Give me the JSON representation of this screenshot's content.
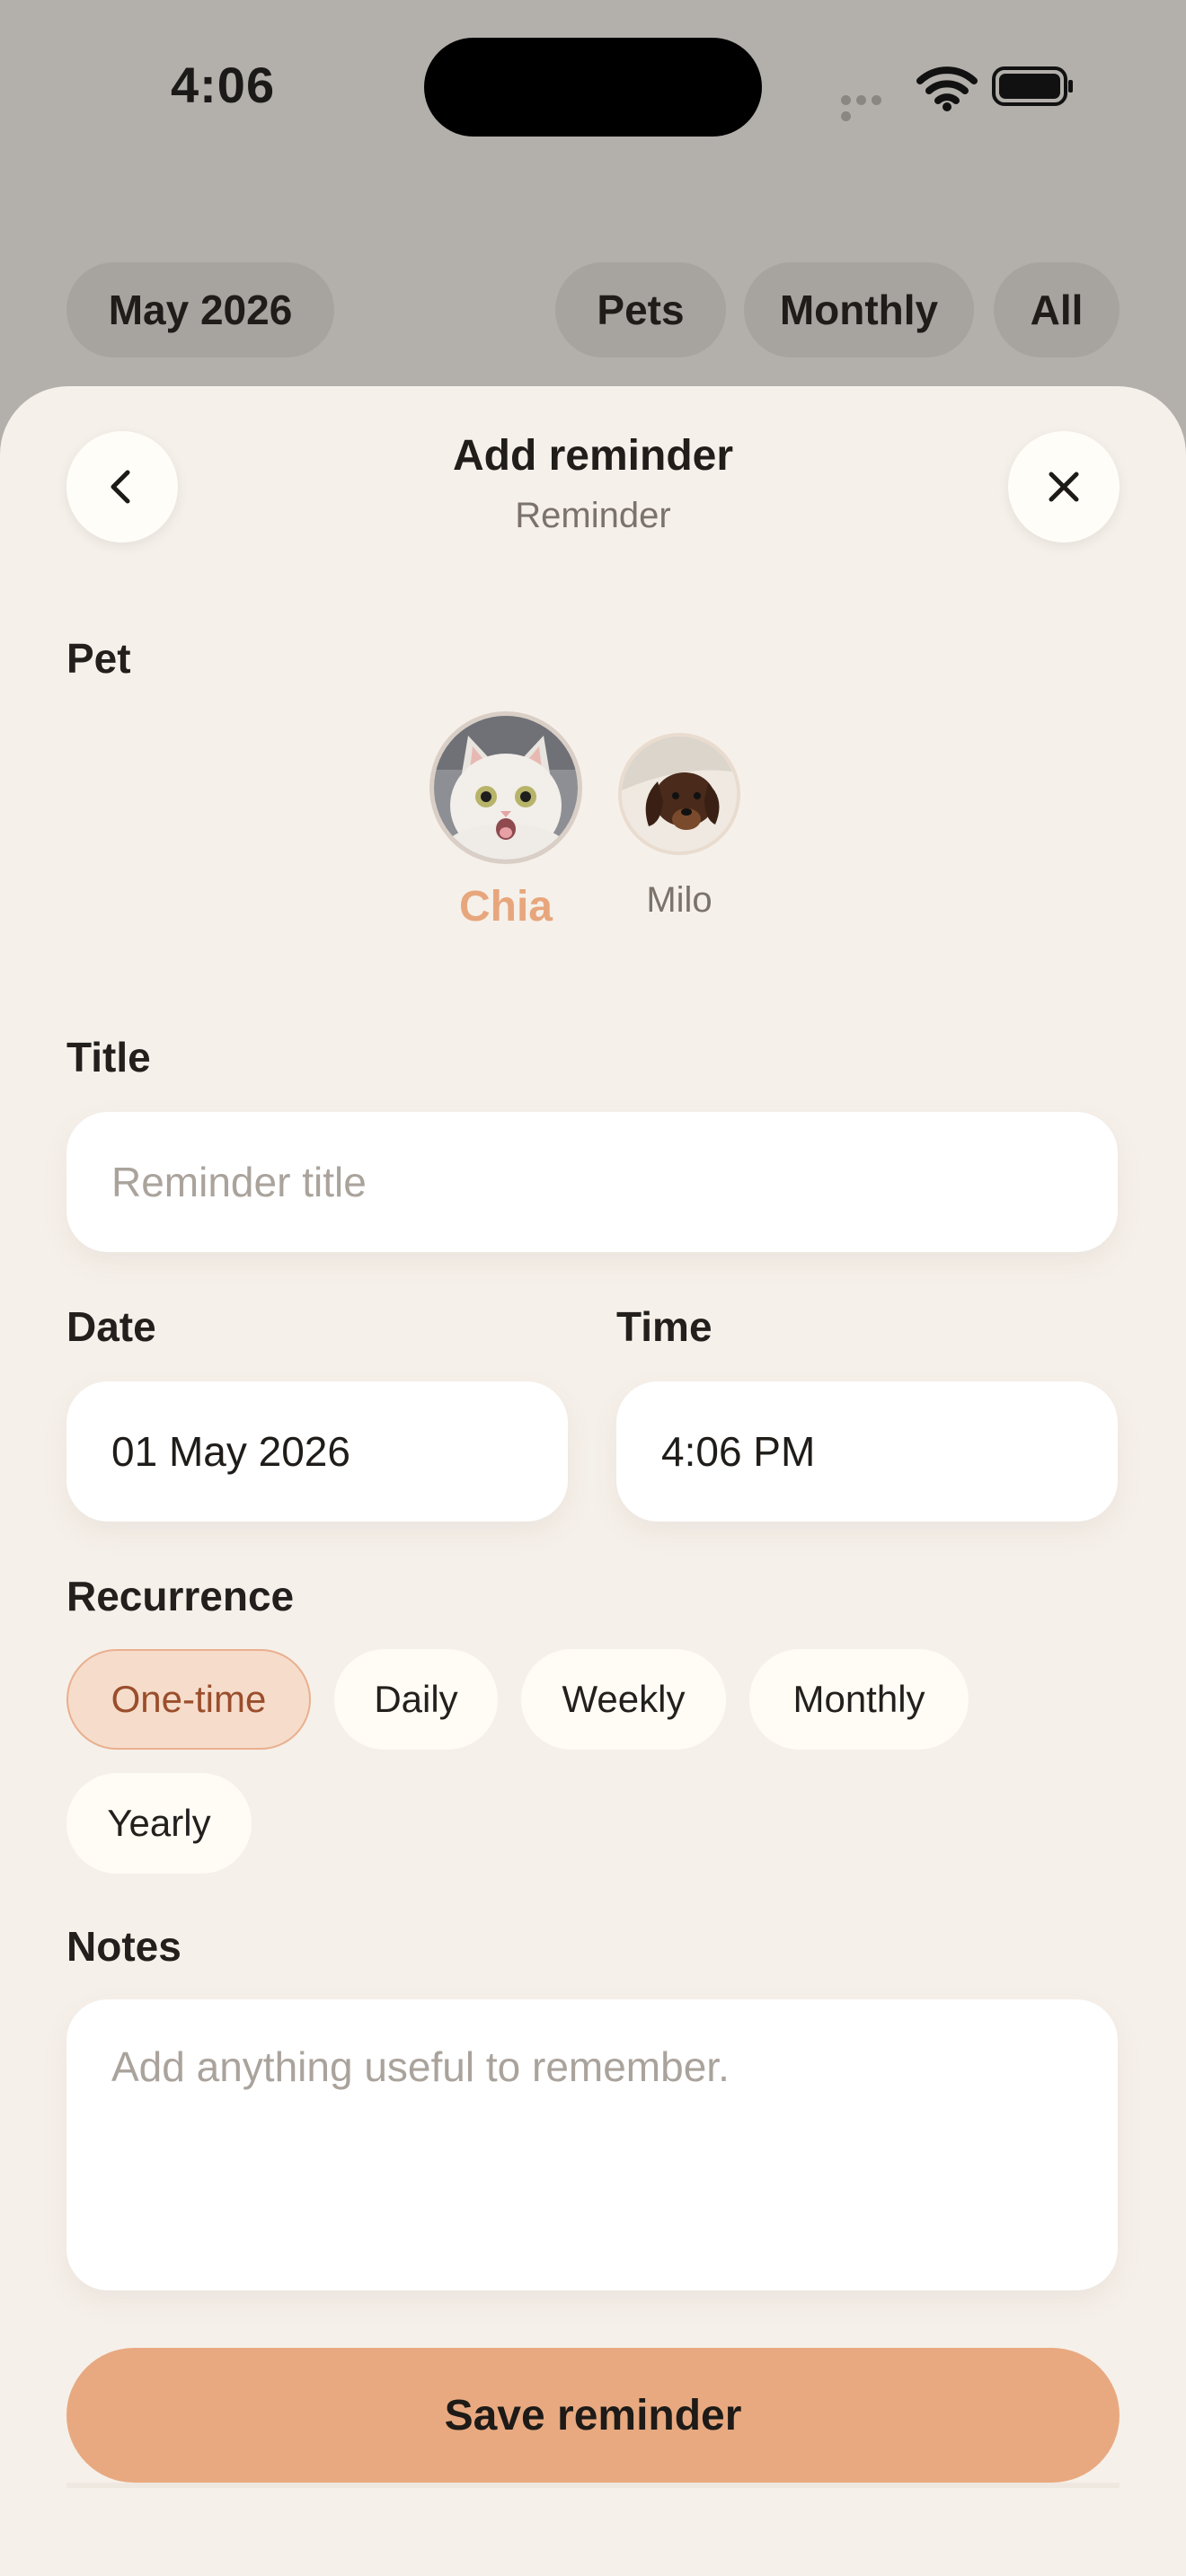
{
  "status_bar": {
    "time": "4:06"
  },
  "filters": {
    "month": "May 2026",
    "pets": "Pets",
    "frequency": "Monthly",
    "all": "All"
  },
  "header": {
    "title": "Add reminder",
    "subtitle": "Reminder"
  },
  "pet_section": {
    "label": "Pet",
    "pets": [
      {
        "name": "Chia",
        "selected": true
      },
      {
        "name": "Milo",
        "selected": false
      }
    ]
  },
  "title_field": {
    "label": "Title",
    "placeholder": "Reminder title",
    "value": ""
  },
  "date_field": {
    "label": "Date",
    "value": "01 May 2026"
  },
  "time_field": {
    "label": "Time",
    "value": "4:06 PM"
  },
  "recurrence": {
    "label": "Recurrence",
    "options": [
      "One-time",
      "Daily",
      "Weekly",
      "Monthly",
      "Yearly"
    ],
    "selected": "One-time"
  },
  "notes": {
    "label": "Notes",
    "placeholder": "Add anything useful to remember."
  },
  "save_button": {
    "label": "Save reminder"
  },
  "colors": {
    "accent": "#e8a980",
    "selected_pet_name": "#e7a67c",
    "sheet_background": "#f6f0ea",
    "backdrop": "#b3afab",
    "selected_chip_bg": "#f6dccb",
    "selected_chip_text": "#9a4e2c"
  }
}
